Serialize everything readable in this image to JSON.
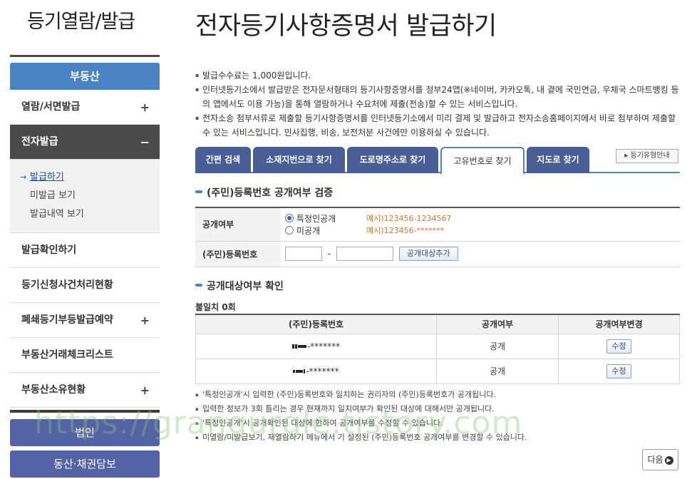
{
  "sidebar": {
    "title": "등기열람/발급",
    "header": "부동산",
    "items": [
      {
        "label": "열람/서면발급",
        "plus": "+"
      },
      {
        "label": "전자발급",
        "plus": "−"
      },
      {
        "label": "발급확인하기",
        "plus": ""
      },
      {
        "label": "등기신청사건처리현황",
        "plus": ""
      },
      {
        "label": "폐쇄등기부등발급예약",
        "plus": "+"
      },
      {
        "label": "부동산거래체크리스트",
        "plus": ""
      },
      {
        "label": "부동산소유현황",
        "plus": "+"
      }
    ],
    "sub_items": [
      "발급하기",
      "미발급 보기",
      "발급내역 보기"
    ],
    "bottom_buttons": [
      "법인",
      "동산·채권담보"
    ]
  },
  "main": {
    "title": "전자등기사항증명서 발급하기",
    "notes": [
      "발급수수료는 1,000원입니다.",
      "인터넷등기소에서 발급받은 전자문서형태의 등기사항증명서를 정부24앱(※네이버, 카카오톡, 내 곁에 국민연금, 우체국 스마트뱅킹 등의 앱에서도 이용 가능)을 통해 열람하거나 수요처에 제출(전송)할 수 있는 서비스입니다.",
      "전자소송 첨부서류로 제출할 등기사항증명서를 인터넷등기소에서 미리 결제 및 발급하고 전자소송홈페이지에서 바로 첨부하여 제출할 수 있는 서비스입니다. 민사집행, 비송, 보전처분 사건에만 이용하실 수 있습니다."
    ],
    "tabs": [
      "간편 검색",
      "소재지번으로 찾기",
      "도로명주소로 찾기",
      "고유번호로 찾기",
      "지도로 찾기"
    ],
    "type_guide": "등기유형안내",
    "section1": "(주민)등록번호 공개여부 검증",
    "form": {
      "row1_label": "공개여부",
      "option1": "특정인공개",
      "option1_eg": "예시)123456-1234567",
      "option2": "미공개",
      "option2_eg": "예시)123456-*******",
      "row2_label": "(주민)등록번호",
      "dash": "-",
      "add_button": "공개대상추가"
    },
    "section2": "공개대상여부 확인",
    "count": "불일치 0회",
    "table": {
      "headers": [
        "(주민)등록번호",
        "공개여부",
        "공개여부변경"
      ],
      "rows": [
        {
          "number_suffix": "-*******",
          "status": "공개",
          "action": "수정"
        },
        {
          "number_suffix": "-*******",
          "status": "공개",
          "action": "수정"
        }
      ]
    },
    "bottom_notes": [
      "'특정인공개'시 입력한 (주민)등록번호와 일치하는 권리자의 (주민)등록번호가 공개됩니다.",
      "입력한 정보가 3회 틀리는 경우 현재까지 일치여부가 확인된 대상에 대해서만 공개됩니다.",
      "'특정인공개'시 공개확인된 대상에 한하여 공개여부를 수정할 수 있습니다.",
      "미열람/미발급보기, 재열람하기 메뉴에서 기 설정된 (주민)등록번호 공개여부를 변경할 수 있습니다."
    ],
    "next_button": "다음"
  },
  "watermark": "https://grangurgle.tistory.com",
  "colors": {
    "accent_blue": "#4a84c4",
    "tab_navy": "#4a5e96",
    "sidebar_active": "#4a4a4a",
    "example_orange": "#d27a3c"
  }
}
